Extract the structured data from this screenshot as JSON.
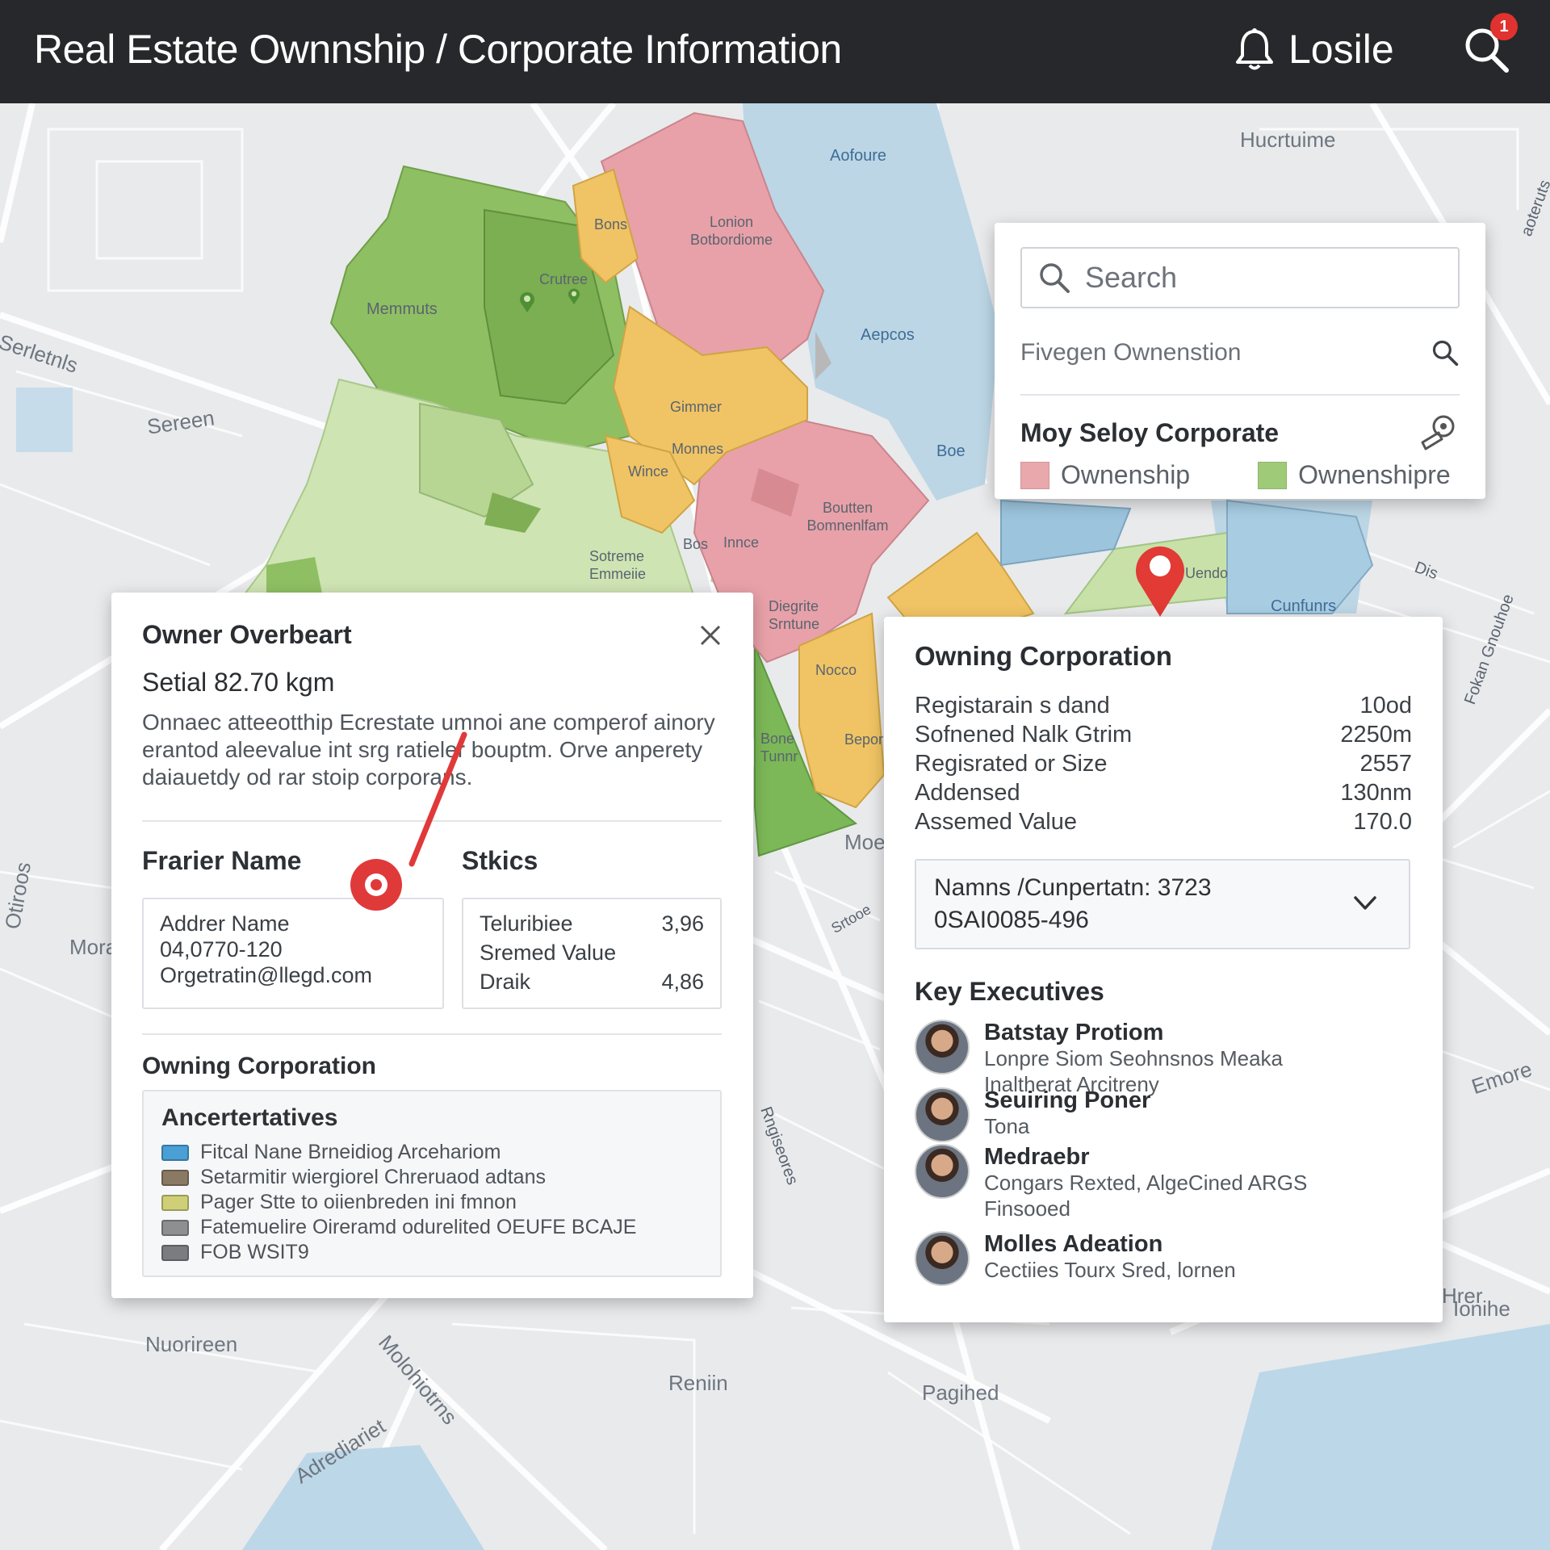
{
  "header": {
    "title": "Real Estate Ownnship / Corporate Information",
    "username": "Losile",
    "notification_count": "1"
  },
  "map_labels": {
    "l1": "Aofoure",
    "l2": "Hucrtuime",
    "l3": "Bons",
    "l4": "Lonion Botbordiome",
    "l5": "Crutree",
    "l6": "Memmuts",
    "l7": "Serletnls",
    "l8": "Sereen",
    "l9": "Aepcos",
    "l10": "Gimmer",
    "l11": "Monnes",
    "l12": "Wince",
    "l13": "Boe",
    "l14": "Boutten Bomnenlfam",
    "l15": "Sotreme Emmeiie",
    "l16": "Bos",
    "l17": "Innce",
    "l18": "Diegrite Srntune",
    "l19": "Uendo",
    "l20": "Cunfunrs",
    "l21": "Dis",
    "l22": "Nocco",
    "l23": "Bone Tunnr",
    "l24": "Bepor",
    "l25": "Moe",
    "l26": "Mora",
    "l27": "Nuorireen",
    "l28": "Reniin",
    "l29": "Pagihed",
    "l30": "Adrediariet",
    "l31": "Molohiotrns",
    "l32": "Srtooe",
    "l33": "Emore",
    "l34": "Fokan Gnouhoe",
    "l35": "Hrer",
    "l36": "Ionihe",
    "l37": "Otiroos",
    "l38": "Rngiseores",
    "l39": "aoteruts"
  },
  "search_panel": {
    "search_placeholder": "Search",
    "filter_label": "Fivegen Ownenstion",
    "corporate_title": "Moy Seloy Corporate",
    "legend": [
      {
        "label": "Ownenship",
        "color": "#e8a8ac"
      },
      {
        "label": "Ownenshipre",
        "color": "#9fca78"
      }
    ]
  },
  "owner_panel": {
    "title": "Owner Overbeart",
    "serial": "Setial 82.70 kgm",
    "description": "Onnaec atteeotthip Ecrestate umnoi ane comperof ainory erantod aleevalue int srg ratieler bouptm. Orve anperety daiauetdy od rar stoip corporans.",
    "name_title": "Frarier Name",
    "name_box": {
      "line1": "Addrer Name",
      "line2": "04,0770-120",
      "line3": "Orgetratin@llegd.com"
    },
    "stats_title": "Stkics",
    "stats": [
      {
        "label": "Teluribiee",
        "value": "3,96"
      },
      {
        "label": "Sremed Value",
        "value": ""
      },
      {
        "label": "Draik",
        "value": "4,86"
      }
    ],
    "owning_corp_title": "Owning Corporation",
    "alternatives_title": "Ancertertatives",
    "alternatives": [
      {
        "text": "Fitcal Nane Brneidiog Arcehariom",
        "color": "#4a9fd4"
      },
      {
        "text": "Setarmitir wiergiorel Chreruaod adtans",
        "color": "#8a7a64"
      },
      {
        "text": "Pager Stte to oiienbreden ini fmnon",
        "color": "#cfcf78"
      },
      {
        "text": "Fatemuelire Oireramd odurelited OEUFE BCAJE",
        "color": "#8d8f92"
      },
      {
        "text": "FOB WSIT9",
        "color": "#7a7d80"
      }
    ]
  },
  "corp_panel": {
    "title": "Owning Corporation",
    "rows": [
      {
        "label": "Registarain s dand",
        "value": "10od"
      },
      {
        "label": "Sofnened Nalk Gtrim",
        "value": "2250m"
      },
      {
        "label": "Regisrated or Size",
        "value": "2557"
      },
      {
        "label": "Addensed",
        "value": "130nm"
      },
      {
        "label": "Assemed Value",
        "value": "170.0"
      }
    ],
    "dropdown_line1": "Namns /Cunpertatn: 3723",
    "dropdown_line2": "0SAI0085-496",
    "executives_title": "Key Executives",
    "executives": [
      {
        "name": "Batstay Protiom",
        "role": "Lonpre Siom Seohnsnos Meaka Inaltherat Arcitreny"
      },
      {
        "name": "Seuiring Poner",
        "role": "Tona"
      },
      {
        "name": "Medraebr",
        "role": "Congars Rexted, AlgeCined ARGS Finsooed"
      },
      {
        "name": "Molles Adeation",
        "role": "Cectiies Tourx Sred, lornen"
      }
    ]
  }
}
